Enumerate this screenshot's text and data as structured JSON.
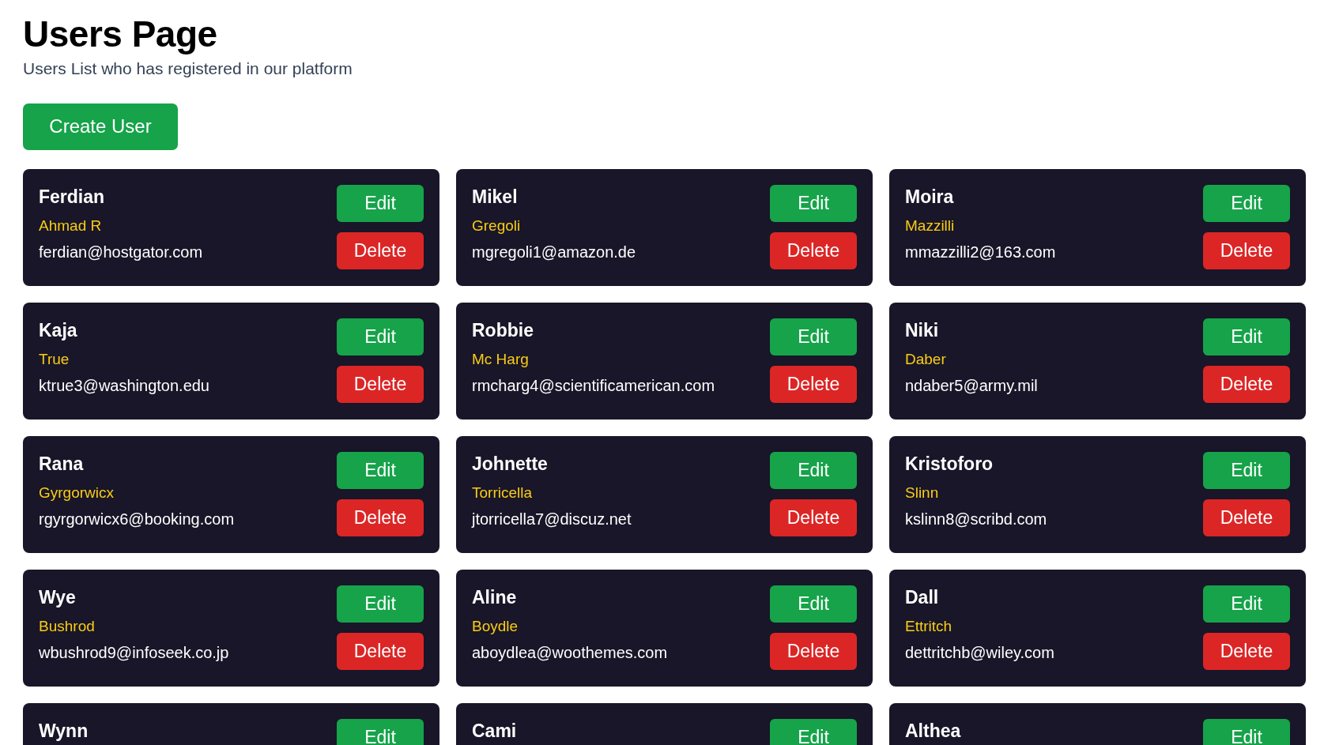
{
  "page": {
    "title": "Users Page",
    "subtitle": "Users List who has registered in our platform",
    "create_button": "Create User"
  },
  "users": [
    {
      "first_name": "Ferdian",
      "last_name": "Ahmad R",
      "email": "ferdian@hostgator.com",
      "edit": "Edit",
      "delete": "Delete"
    },
    {
      "first_name": "Mikel",
      "last_name": "Gregoli",
      "email": "mgregoli1@amazon.de",
      "edit": "Edit",
      "delete": "Delete"
    },
    {
      "first_name": "Moira",
      "last_name": "Mazzilli",
      "email": "mmazzilli2@163.com",
      "edit": "Edit",
      "delete": "Delete"
    },
    {
      "first_name": "Kaja",
      "last_name": "True",
      "email": "ktrue3@washington.edu",
      "edit": "Edit",
      "delete": "Delete"
    },
    {
      "first_name": "Robbie",
      "last_name": "Mc Harg",
      "email": "rmcharg4@scientificamerican.com",
      "edit": "Edit",
      "delete": "Delete"
    },
    {
      "first_name": "Niki",
      "last_name": "Daber",
      "email": "ndaber5@army.mil",
      "edit": "Edit",
      "delete": "Delete"
    },
    {
      "first_name": "Rana",
      "last_name": "Gyrgorwicx",
      "email": "rgyrgorwicx6@booking.com",
      "edit": "Edit",
      "delete": "Delete"
    },
    {
      "first_name": "Johnette",
      "last_name": "Torricella",
      "email": "jtorricella7@discuz.net",
      "edit": "Edit",
      "delete": "Delete"
    },
    {
      "first_name": "Kristoforo",
      "last_name": "Slinn",
      "email": "kslinn8@scribd.com",
      "edit": "Edit",
      "delete": "Delete"
    },
    {
      "first_name": "Wye",
      "last_name": "Bushrod",
      "email": "wbushrod9@infoseek.co.jp",
      "edit": "Edit",
      "delete": "Delete"
    },
    {
      "first_name": "Aline",
      "last_name": "Boydle",
      "email": "aboydlea@woothemes.com",
      "edit": "Edit",
      "delete": "Delete"
    },
    {
      "first_name": "Dall",
      "last_name": "Ettritch",
      "email": "dettritchb@wiley.com",
      "edit": "Edit",
      "delete": "Delete"
    },
    {
      "first_name": "Wynn",
      "edit": "Edit"
    },
    {
      "first_name": "Cami",
      "edit": "Edit"
    },
    {
      "first_name": "Althea",
      "edit": "Edit"
    }
  ]
}
